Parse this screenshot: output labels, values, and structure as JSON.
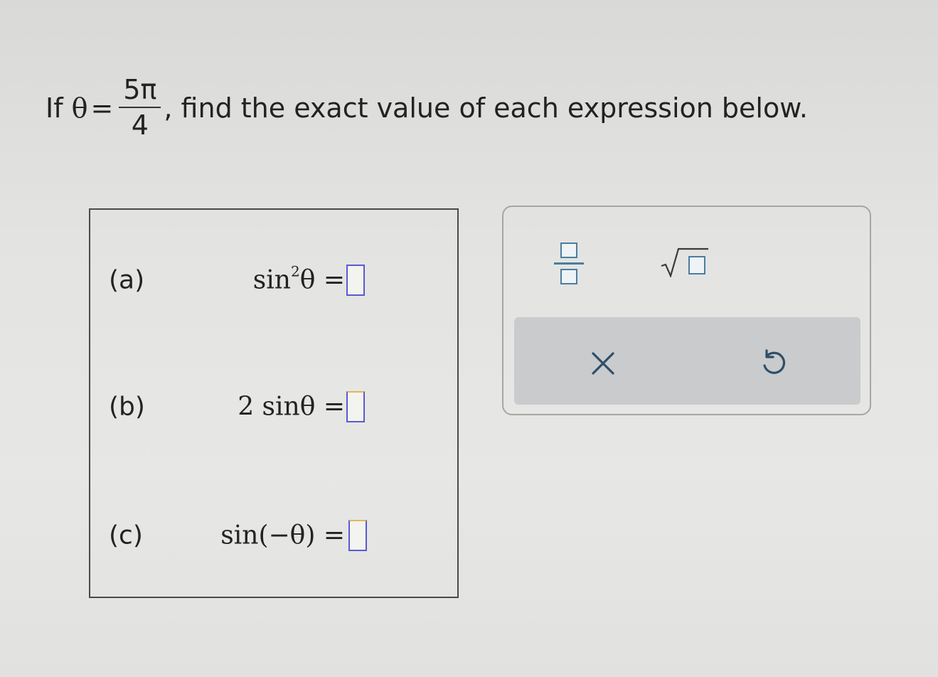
{
  "question": {
    "prefix": "If",
    "variable": "θ",
    "equals": "=",
    "numerator": "5π",
    "denominator": "4",
    "suffix": ", find the exact value of each expression below."
  },
  "answers": [
    {
      "label": "(a)",
      "expression_base": "sin",
      "expression_exp": "2",
      "expression_arg": "θ ="
    },
    {
      "label": "(b)",
      "expression": "2 sinθ ="
    },
    {
      "label": "(c)",
      "expression": "sin(−θ) ="
    }
  ],
  "toolbox": {
    "tools": [
      "fraction-icon",
      "square-root-icon",
      "clear-icon",
      "undo-icon"
    ],
    "clear_symbol": "×",
    "accent_color": "#4a7ea0"
  }
}
